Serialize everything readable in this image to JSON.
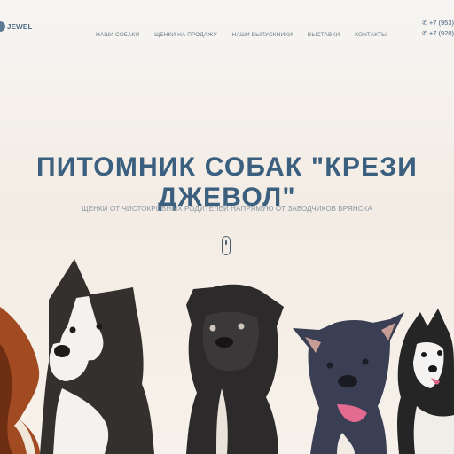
{
  "header": {
    "logo_text": "JEWEL",
    "nav": [
      "НАШИ СОБАКИ",
      "ЩЕНКИ НА ПРОДАЖУ",
      "НАШИ ВЫПУСКНИКИ",
      "ВЫСТАВКИ",
      "КОНТАКТЫ"
    ],
    "phones": [
      "+7 (953)",
      "+7 (920)"
    ],
    "phone_icon": "phone-icon"
  },
  "hero": {
    "title": "ПИТОМНИК СОБАК \"КРЕЗИ ДЖЕВОЛ\"",
    "subtitle": "ЩЕНКИ ОТ ЧИСТОКРОВНЫХ РОДИТЕЛЕЙ НАПРЯМУЮ ОТ ЗАВОДЧИКОВ БРЯНСКА",
    "scroll_icon": "mouse-scroll-icon"
  },
  "colors": {
    "title": "#3b5f7f",
    "nav": "#6e7b88",
    "background": "#f5efe8"
  }
}
